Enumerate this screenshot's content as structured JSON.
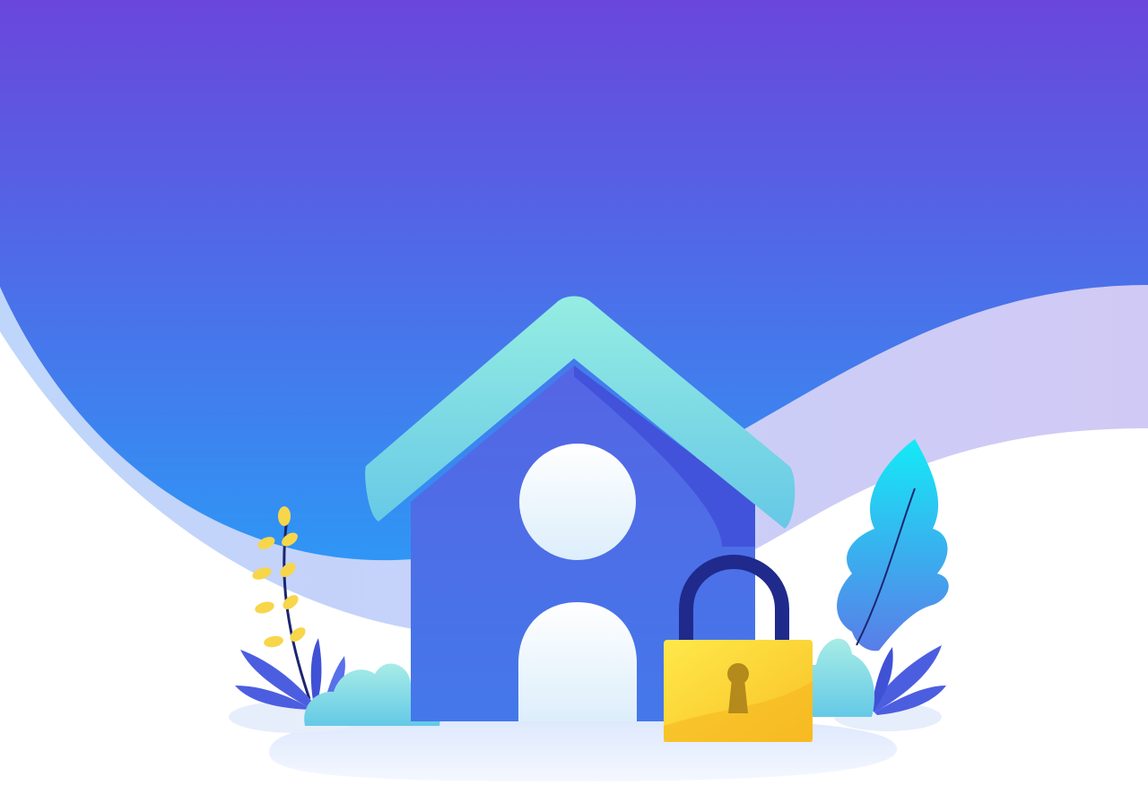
{
  "illustration": {
    "subject": "house-with-padlock",
    "icons": [
      "house-icon",
      "padlock-icon",
      "keyhole-icon",
      "leaf-plant-icon",
      "bush-icon"
    ]
  },
  "colors": {
    "sky_top": "#6a46dc",
    "sky_bottom": "#2f96f5",
    "wave_light": "#c9d2f6",
    "roof": "#7fdfe6",
    "house_wall": "#4e68e6",
    "house_wall_shadow": "#3f4fd8",
    "window": "#f0f7fd",
    "lock_body": "#fbd63a",
    "lock_shackle": "#1f2a8c",
    "keyhole": "#b58a1c",
    "plant_yellow": "#f7d64a",
    "plant_stem": "#1d2670",
    "leaf_blue": "#4c5ee0",
    "leaf_cyan": "#2fd6f2",
    "bush": "#84dfe9",
    "ground_shadow": "#e7efff"
  }
}
